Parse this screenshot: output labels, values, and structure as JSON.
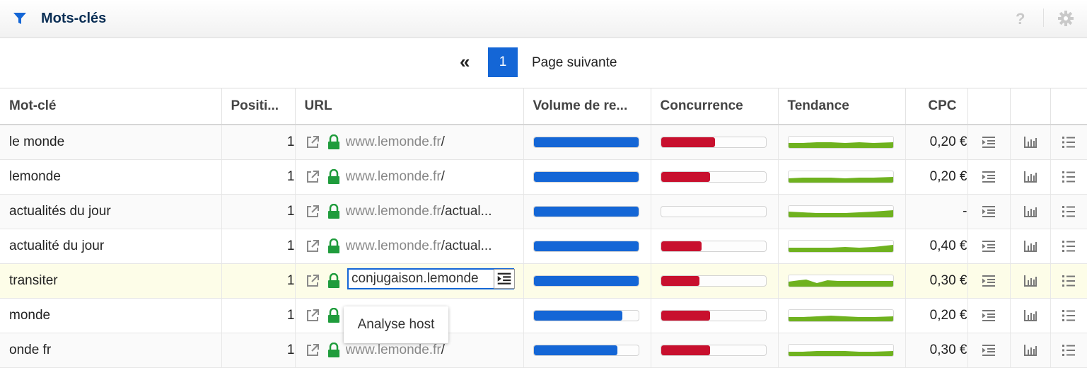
{
  "header": {
    "title": "Mots-clés",
    "help_glyph": "?",
    "icons": [
      "filter-icon",
      "help-icon",
      "gear-icon"
    ]
  },
  "pagination": {
    "first_glyph": "«",
    "current_page": "1",
    "next_label": "Page suivante"
  },
  "table": {
    "columns": [
      "Mot-clé",
      "Positi...",
      "URL",
      "Volume de re...",
      "Concurrence",
      "Tendance",
      "CPC"
    ],
    "rows": [
      {
        "keyword": "le monde",
        "position": "1",
        "url_host": "www.lemonde.fr",
        "url_path": "/",
        "volume": 1.0,
        "competition": 0.52,
        "cpc": "0,20 €"
      },
      {
        "keyword": "lemonde",
        "position": "1",
        "url_host": "www.lemonde.fr",
        "url_path": "/",
        "volume": 1.0,
        "competition": 0.47,
        "cpc": "0,20 €"
      },
      {
        "keyword": "actualités du jour",
        "position": "1",
        "url_host": "www.lemonde.fr",
        "url_path": "/actual...",
        "volume": 1.0,
        "competition": 0.0,
        "cpc": "-"
      },
      {
        "keyword": "actualité du jour",
        "position": "1",
        "url_host": "www.lemonde.fr",
        "url_path": "/actual...",
        "volume": 1.0,
        "competition": 0.39,
        "cpc": "0,40 €"
      },
      {
        "keyword": "transiter",
        "position": "1",
        "url_host": "conjugaison.lemonde",
        "url_path": "",
        "volume": 1.0,
        "competition": 0.37,
        "cpc": "0,30 €"
      },
      {
        "keyword": "monde",
        "position": "1",
        "url_host": "",
        "url_path": "fr/",
        "volume": 0.85,
        "competition": 0.47,
        "cpc": "0,20 €"
      },
      {
        "keyword": "onde fr",
        "position": "1",
        "url_host": "www.lemonde.fr",
        "url_path": "/",
        "volume": 0.8,
        "competition": 0.47,
        "cpc": "0,30 €"
      }
    ]
  },
  "tooltip": {
    "text": "Analyse host"
  },
  "colors": {
    "accent": "#1466d6",
    "volume_bar": "#1466d6",
    "competition_bar": "#c8102e",
    "trend": "#6fb21f",
    "lock": "#1f9c3c"
  }
}
